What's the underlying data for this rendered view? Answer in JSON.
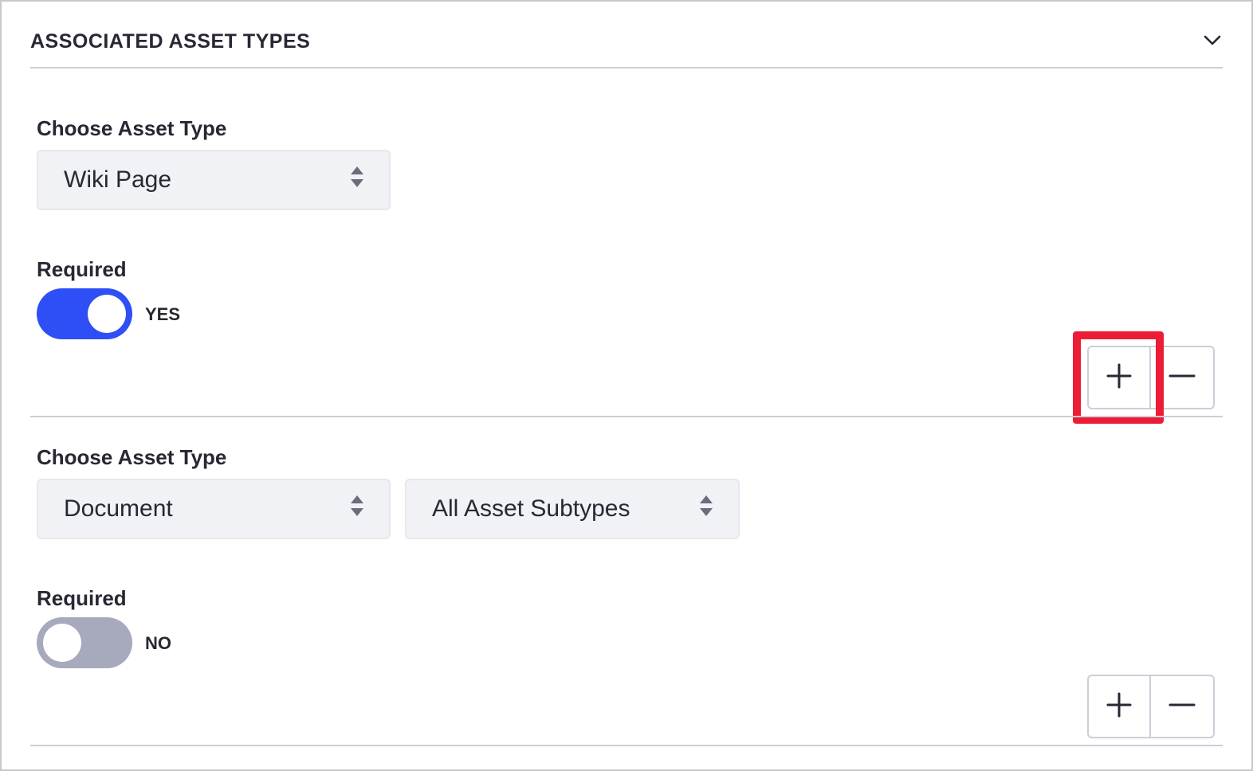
{
  "panel": {
    "title": "ASSOCIATED ASSET TYPES",
    "collapse_icon": "chevron-down-icon"
  },
  "rows": [
    {
      "choose_label": "Choose Asset Type",
      "asset_type": "Wiki Page",
      "required_label": "Required",
      "required": true,
      "toggle_text": "YES",
      "add_icon": "plus-icon",
      "remove_icon": "minus-icon",
      "add_highlighted": true
    },
    {
      "choose_label": "Choose Asset Type",
      "asset_type": "Document",
      "asset_subtype": "All Asset Subtypes",
      "required_label": "Required",
      "required": false,
      "toggle_text": "NO",
      "add_icon": "plus-icon",
      "remove_icon": "minus-icon"
    }
  ],
  "colors": {
    "toggle_on": "#2e4ff5",
    "toggle_off": "#a7a9bc",
    "highlight": "#ed1c36",
    "select_bg": "#f1f2f5"
  }
}
